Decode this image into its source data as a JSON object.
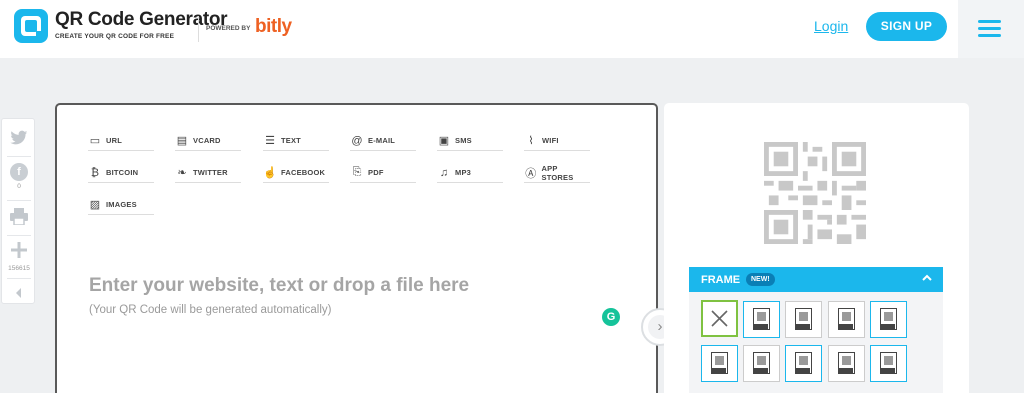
{
  "header": {
    "brand_title": "QR Code Generator",
    "brand_sub": "CREATE YOUR QR CODE FOR FREE",
    "powered_by": "POWERED BY",
    "partner": "bitly",
    "login_label": "Login",
    "signup_label": "SIGN UP"
  },
  "share": {
    "facebook_count": "0",
    "add_count": "156615"
  },
  "types": [
    {
      "label": "URL",
      "icon": "url-icon"
    },
    {
      "label": "VCARD",
      "icon": "vcard-icon"
    },
    {
      "label": "TEXT",
      "icon": "text-icon"
    },
    {
      "label": "E-MAIL",
      "icon": "email-icon"
    },
    {
      "label": "SMS",
      "icon": "sms-icon"
    },
    {
      "label": "WIFI",
      "icon": "wifi-icon"
    },
    {
      "label": "BITCOIN",
      "icon": "bitcoin-icon"
    },
    {
      "label": "TWITTER",
      "icon": "twitter-icon"
    },
    {
      "label": "FACEBOOK",
      "icon": "facebook-icon"
    },
    {
      "label": "PDF",
      "icon": "pdf-icon"
    },
    {
      "label": "MP3",
      "icon": "music-icon"
    },
    {
      "label": "APP STORES",
      "icon": "app-store-icon"
    },
    {
      "label": "IMAGES",
      "icon": "image-icon"
    }
  ],
  "main": {
    "placeholder": "Enter your website, text or drop a file here",
    "hint": "(Your QR Code will be generated automatically)"
  },
  "frame": {
    "title": "FRAME",
    "badge": "NEW!"
  },
  "colors": {
    "accent": "#1bb7ec",
    "bitly": "#ee6123",
    "selected_frame": "#7fc241"
  }
}
